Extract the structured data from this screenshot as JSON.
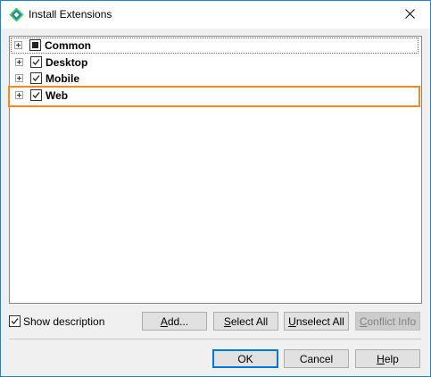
{
  "window": {
    "title": "Install Extensions"
  },
  "tree": {
    "items": [
      {
        "label": "Common",
        "check_state": "partial"
      },
      {
        "label": "Desktop",
        "check_state": "checked"
      },
      {
        "label": "Mobile",
        "check_state": "checked"
      },
      {
        "label": "Web",
        "check_state": "checked",
        "highlighted": true
      }
    ]
  },
  "options": {
    "show_description_label": "Show description",
    "show_description_checked": true
  },
  "buttons": {
    "add_prefix": "A",
    "add_rest": "dd...",
    "select_all_prefix": "S",
    "select_all_rest": "elect All",
    "unselect_all_prefix": "U",
    "unselect_all_rest": "nselect All",
    "conflict_info_prefix": "C",
    "conflict_info_rest": "onflict Info",
    "ok": "OK",
    "cancel": "Cancel",
    "help_prefix": "H",
    "help_rest": "elp"
  },
  "colors": {
    "highlight_border": "#f08c1e",
    "window_border": "#1883d7",
    "default_button_border": "#0078d7"
  },
  "icons": {
    "app": "app-logo-icon",
    "close": "close-icon",
    "expander": "expand-plus-icon",
    "checkmark": "checkmark-icon"
  }
}
